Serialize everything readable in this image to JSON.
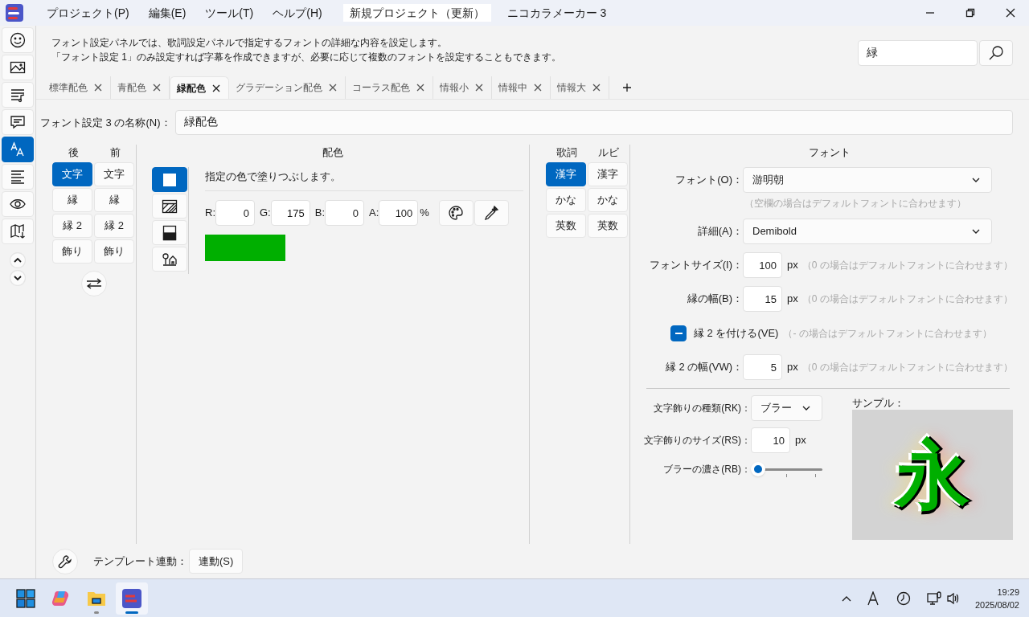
{
  "menu": [
    {
      "label": "プロジェクト(P)"
    },
    {
      "label": "編集(E)"
    },
    {
      "label": "ツール(T)"
    },
    {
      "label": "ヘルプ(H)"
    }
  ],
  "document_title": "新規プロジェクト（更新）",
  "app_title": "ニコカラメーカー 3",
  "sidebar": {
    "items": [
      {
        "kind": "smiley",
        "selected": false
      },
      {
        "kind": "image",
        "selected": false
      },
      {
        "kind": "music",
        "selected": false
      },
      {
        "kind": "comment",
        "selected": false
      },
      {
        "kind": "font",
        "selected": true
      },
      {
        "kind": "align",
        "selected": false
      },
      {
        "kind": "eye",
        "selected": false
      },
      {
        "kind": "map",
        "selected": false
      }
    ]
  },
  "description": [
    "フォント設定パネルでは、歌詞設定パネルで指定するフォントの詳細な内容を設定します。",
    "「フォント設定 1」のみ設定すれば字幕を作成できますが、必要に応じて複数のフォントを設定することもできます。"
  ],
  "search": {
    "value": "緑"
  },
  "tabs": [
    {
      "label": "標準配色",
      "selected": false
    },
    {
      "label": "青配色",
      "selected": false
    },
    {
      "label": "緑配色",
      "selected": true
    },
    {
      "label": "グラデーション配色",
      "selected": false
    },
    {
      "label": "コーラス配色",
      "selected": false
    },
    {
      "label": "情報小",
      "selected": false
    },
    {
      "label": "情報中",
      "selected": false
    },
    {
      "label": "情報大",
      "selected": false
    }
  ],
  "name_field": {
    "label": "フォント設定 3 の名称(N)：",
    "value": "緑配色"
  },
  "layer_selector": {
    "headers": [
      "後",
      "前"
    ],
    "rows": [
      [
        {
          "label": "文字",
          "selected": true
        },
        {
          "label": "文字",
          "selected": false
        }
      ],
      [
        {
          "label": "縁",
          "selected": false
        },
        {
          "label": "縁",
          "selected": false
        }
      ],
      [
        {
          "label": "縁 2",
          "selected": false
        },
        {
          "label": "縁 2",
          "selected": false
        }
      ],
      [
        {
          "label": "飾り",
          "selected": false
        },
        {
          "label": "飾り",
          "selected": false
        }
      ]
    ]
  },
  "coloring": {
    "title": "配色",
    "modes": [
      {
        "kind": "solid",
        "selected": true
      },
      {
        "kind": "hatch",
        "selected": false
      },
      {
        "kind": "gradient",
        "selected": false
      },
      {
        "kind": "picture",
        "selected": false
      }
    ],
    "hint": "指定の色で塗りつぶします。",
    "channels": [
      {
        "label": "R:",
        "value": "0"
      },
      {
        "label": "G:",
        "value": "175"
      },
      {
        "label": "B:",
        "value": "0"
      },
      {
        "label": "A:",
        "value": "100"
      }
    ],
    "unit": "%",
    "color": "#00af00"
  },
  "char_type": {
    "headers": [
      "歌詞",
      "ルビ"
    ],
    "rows": [
      [
        {
          "label": "漢字",
          "selected": true
        },
        {
          "label": "漢字",
          "selected": false
        }
      ],
      [
        {
          "label": "かな",
          "selected": false
        },
        {
          "label": "かな",
          "selected": false
        }
      ],
      [
        {
          "label": "英数",
          "selected": false
        },
        {
          "label": "英数",
          "selected": false
        }
      ]
    ]
  },
  "font": {
    "title": "フォント",
    "font_select": {
      "label": "フォント(O)：",
      "value": "游明朝",
      "hint": "（空欄の場合はデフォルトフォントに合わせます）"
    },
    "detail_select": {
      "label": "詳細(A)：",
      "value": "Demibold"
    },
    "font_size": {
      "label": "フォントサイズ(I)：",
      "value": "100",
      "unit": "px",
      "hint": "（0 の場合はデフォルトフォントに合わせます）"
    },
    "border_width": {
      "label": "縁の幅(B)：",
      "value": "15",
      "unit": "px",
      "hint": "（0 の場合はデフォルトフォントに合わせます）"
    },
    "border2_toggle": {
      "label": "縁 2 を付ける(VE)",
      "indeterminate": true,
      "hint": "（- の場合はデフォルトフォントに合わせます）"
    },
    "border2_width": {
      "label": "縁 2 の幅(VW)：",
      "value": "5",
      "unit": "px",
      "hint": "（0 の場合はデフォルトフォントに合わせます）"
    }
  },
  "decoration": {
    "type_select": {
      "label": "文字飾りの種類(RK)：",
      "value": "ブラー"
    },
    "size": {
      "label": "文字飾りのサイズ(RS)：",
      "value": "10",
      "unit": "px"
    },
    "blur": {
      "label": "ブラーの濃さ(RB)：",
      "level": 0
    }
  },
  "sample": {
    "label": "サンプル：",
    "glyph": "永"
  },
  "footer": {
    "label": "テンプレート連動：",
    "button": "連動(S)"
  },
  "taskbar": {
    "apps": [
      {
        "kind": "start",
        "running": false,
        "selected": false
      },
      {
        "kind": "copilot",
        "running": false,
        "selected": false
      },
      {
        "kind": "folder",
        "running": true,
        "selected": false
      },
      {
        "kind": "app",
        "running": true,
        "selected": true
      }
    ],
    "time": "19:29",
    "date": "2025/08/02"
  }
}
